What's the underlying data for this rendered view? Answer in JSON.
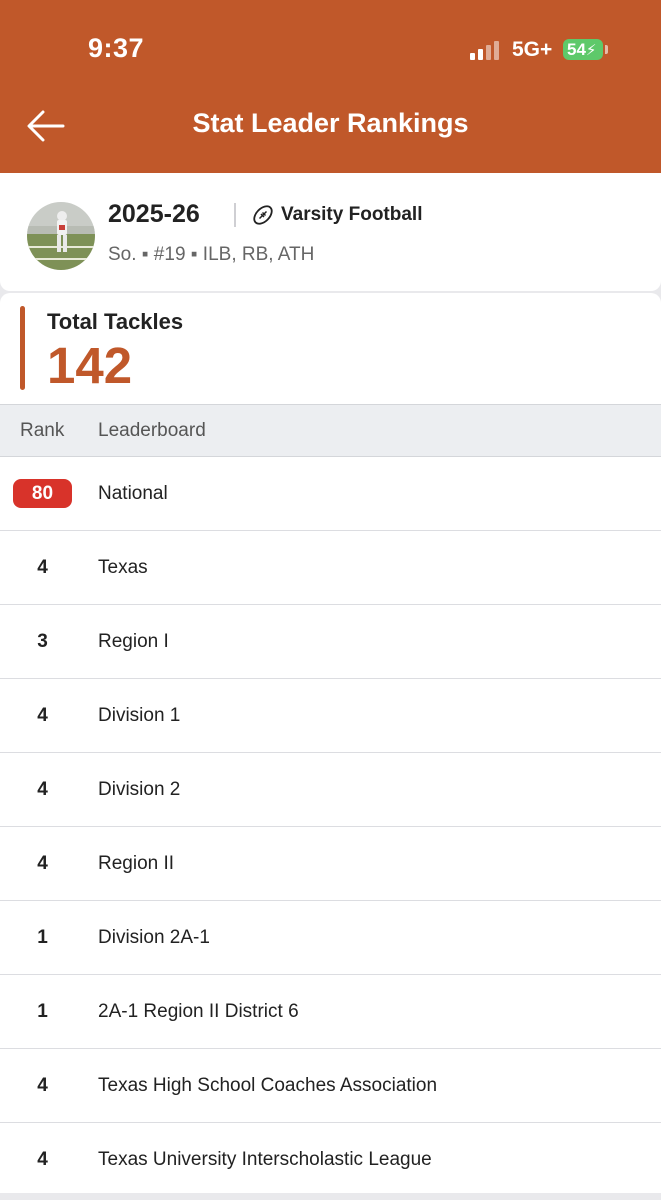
{
  "status_bar": {
    "time": "9:37",
    "network": "5G+",
    "battery": "54"
  },
  "header": {
    "title": "Stat Leader Rankings"
  },
  "profile": {
    "season": "2025-26",
    "sport": "Varsity Football",
    "meta": "So. ▪ #19 ▪ ILB, RB, ATH"
  },
  "stat": {
    "label": "Total Tackles",
    "value": "142"
  },
  "table": {
    "headers": {
      "rank": "Rank",
      "leaderboard": "Leaderboard"
    },
    "rows": [
      {
        "rank": "80",
        "leaderboard": "National",
        "highlight": true
      },
      {
        "rank": "4",
        "leaderboard": "Texas"
      },
      {
        "rank": "3",
        "leaderboard": "Region I"
      },
      {
        "rank": "4",
        "leaderboard": "Division 1"
      },
      {
        "rank": "4",
        "leaderboard": "Division 2"
      },
      {
        "rank": "4",
        "leaderboard": "Region II"
      },
      {
        "rank": "1",
        "leaderboard": "Division 2A-1"
      },
      {
        "rank": "1",
        "leaderboard": "2A-1 Region II District 6"
      },
      {
        "rank": "4",
        "leaderboard": "Texas High School Coaches Association"
      },
      {
        "rank": "4",
        "leaderboard": "Texas University Interscholastic League"
      }
    ]
  },
  "colors": {
    "accent": "#c0582a",
    "rank_badge": "#d8332a",
    "battery": "#5ec96a"
  },
  "icons": {
    "back": "arrow-left-icon",
    "sport": "football-icon"
  }
}
